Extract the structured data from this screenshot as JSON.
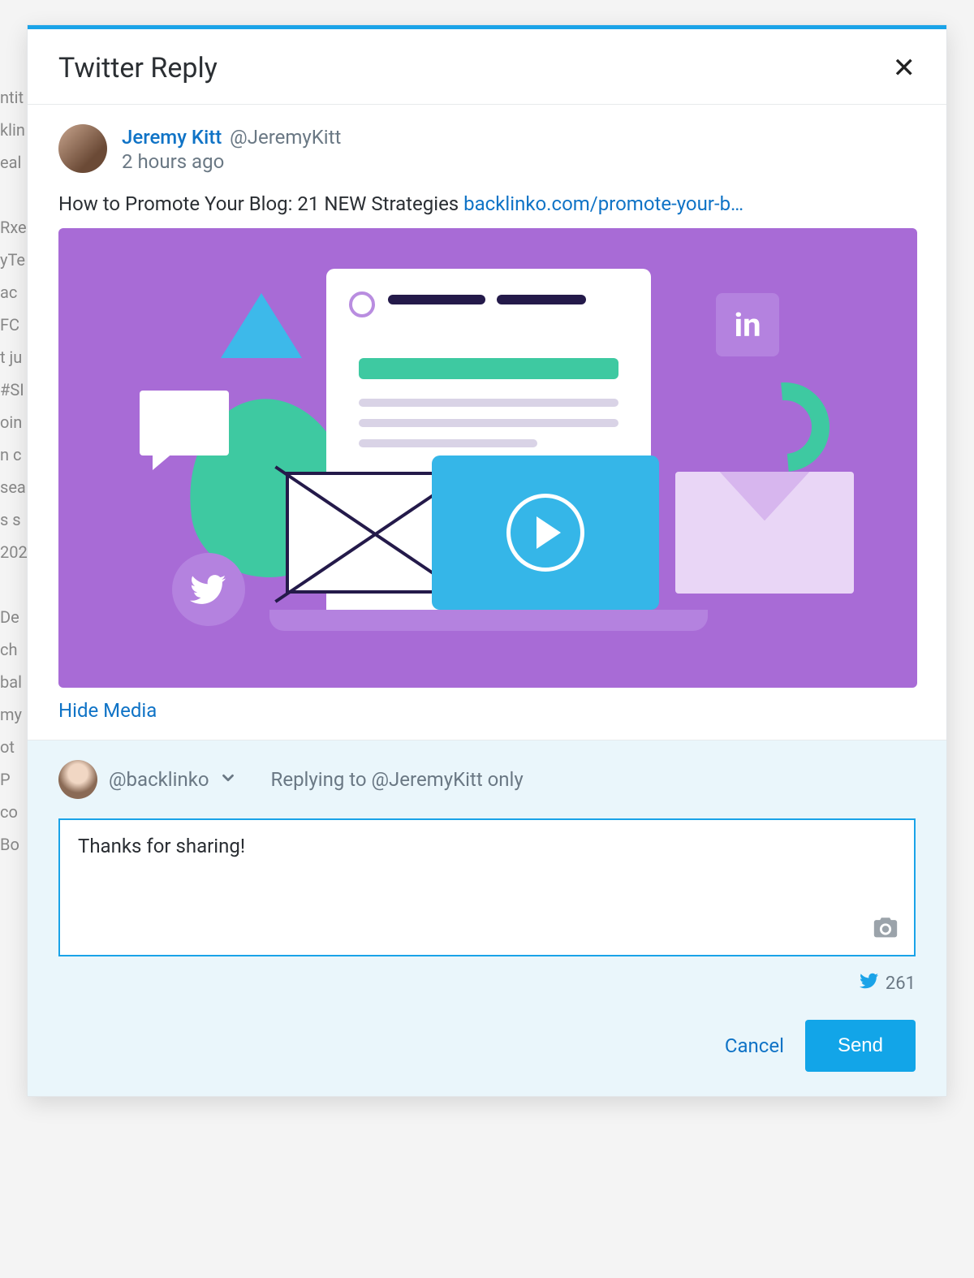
{
  "modal": {
    "title": "Twitter Reply",
    "close_label": "Close"
  },
  "tweet": {
    "author_name": "Jeremy Kitt",
    "author_handle": "@JeremyKitt",
    "time_ago": "2 hours ago",
    "text": "How to Promote Your Blog: 21 NEW Strategies ",
    "link_text": "backlinko.com/promote-your-b…",
    "hide_media_label": "Hide Media"
  },
  "reply": {
    "me_handle": "@backlinko",
    "context": "Replying to @JeremyKitt only",
    "draft_text": "Thanks for sharing!",
    "char_count": "261",
    "cancel_label": "Cancel",
    "send_label": "Send"
  },
  "colors": {
    "accent": "#1aa3e8",
    "link": "#0f73c6",
    "media_bg": "#a86bd6"
  }
}
